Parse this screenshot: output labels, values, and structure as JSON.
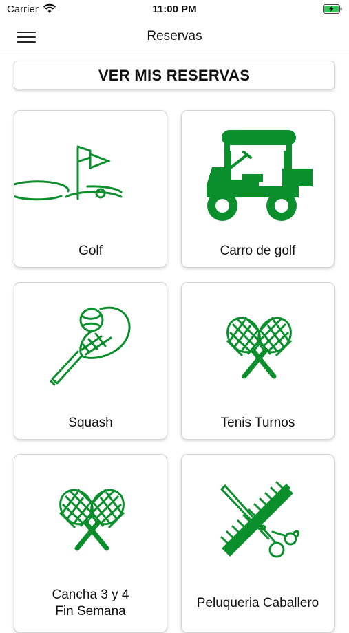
{
  "status_bar": {
    "carrier": "Carrier",
    "time": "11:00 PM",
    "wifi_icon": "wifi-icon",
    "battery_icon": "battery-charging-icon"
  },
  "nav": {
    "title": "Reservas",
    "menu_icon": "hamburger-menu-icon"
  },
  "cta": {
    "label": "VER MIS RESERVAS"
  },
  "accent_color": "#0a8f2c",
  "cards": [
    {
      "label": "Golf",
      "icon": "golf-flag-icon"
    },
    {
      "label": "Carro de golf",
      "icon": "golf-cart-icon"
    },
    {
      "label": "Squash",
      "icon": "squash-racket-icon"
    },
    {
      "label": "Tenis Turnos",
      "icon": "crossed-rackets-icon"
    },
    {
      "label_line1": "Cancha 3 y 4",
      "label_line2": "Fin Semana",
      "icon": "crossed-rackets-icon"
    },
    {
      "label": "Peluqueria Caballero",
      "icon": "scissors-comb-icon"
    }
  ]
}
